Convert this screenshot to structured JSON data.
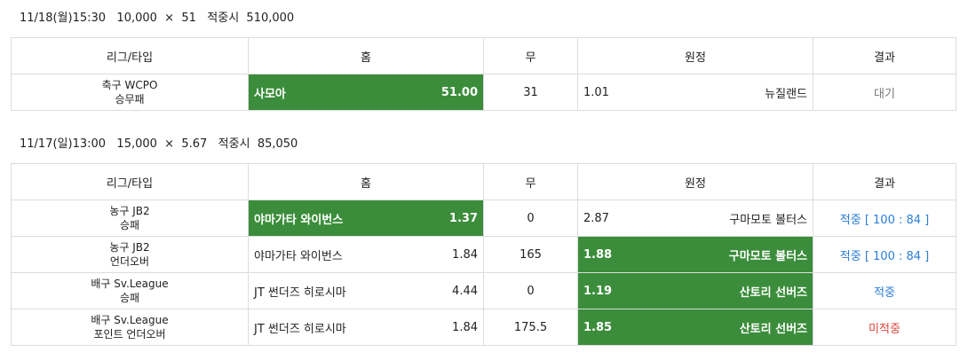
{
  "slips": [
    {
      "summary": "11/18(월)15:30   10,000  ×  51   적중시  510,000",
      "headers": [
        "리그/타입",
        "홈",
        "무",
        "원정",
        "결과"
      ],
      "rows": [
        {
          "league": "축구 WCPO",
          "type": "승무패",
          "home": "사모아",
          "home_odds": "51.00",
          "draw": "31",
          "away_odds": "1.01",
          "away": "뉴질랜드",
          "result": "대기"
        }
      ]
    },
    {
      "summary": "11/17(일)13:00   15,000  ×  5.67   적중시  85,050",
      "headers": [
        "리그/타입",
        "홈",
        "무",
        "원정",
        "결과"
      ],
      "rows": [
        {
          "league": "농구 JB2",
          "type": "승패",
          "home": "야마가타 와이번스",
          "home_odds": "1.37",
          "draw": "0",
          "away_odds": "2.87",
          "away": "구마모토 볼터스",
          "result": "적중 [ 100 : 84 ]"
        },
        {
          "league": "농구 JB2",
          "type": "언더오버",
          "home": "야마가타 와이번스",
          "home_odds": "1.84",
          "draw": "165",
          "away_odds": "1.88",
          "away": "구마모토 볼터스",
          "result": "적중 [ 100 : 84 ]"
        },
        {
          "league": "배구 Sv.League",
          "type": "승패",
          "home": "JT 썬더즈 히로시마",
          "home_odds": "4.44",
          "draw": "0",
          "away_odds": "1.19",
          "away": "산토리 선버즈",
          "result": "적중"
        },
        {
          "league": "배구 Sv.League",
          "type": "포인트 언더오버",
          "home": "JT 썬더즈 히로시마",
          "home_odds": "1.84",
          "draw": "175.5",
          "away_odds": "1.85",
          "away": "산토리 선버즈",
          "result": "미적중"
        }
      ]
    }
  ]
}
